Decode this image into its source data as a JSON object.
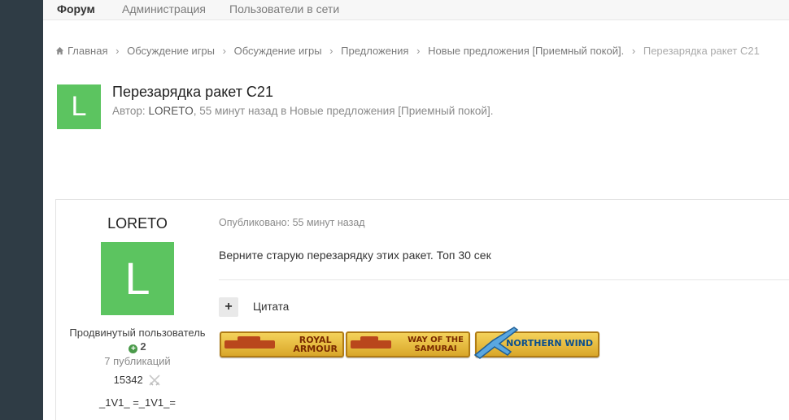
{
  "nav": {
    "items": [
      "Форум",
      "Администрация",
      "Пользователи в сети"
    ],
    "active_index": 0
  },
  "breadcrumb": {
    "items": [
      "Главная",
      "Обсуждение игры",
      "Обсуждение игры",
      "Предложения",
      "Новые предложения [Приемный покой]."
    ],
    "current": "Перезарядка ракет C21",
    "separator": "›"
  },
  "topic": {
    "avatar_letter": "L",
    "title": "Перезарядка ракет C21",
    "meta_prefix": "Автор:",
    "author": "LORETO",
    "meta_suffix": ", 55 минут назад в Новые предложения [Приемный покой]."
  },
  "post": {
    "author_name": "LORETO",
    "avatar_letter": "L",
    "rank": "Продвинутый пользователь",
    "reputation": "2",
    "publications": "7 публикаций",
    "stat_value": "15342",
    "signature": "_1V1_ =_1V1_=",
    "date": "Опубликовано: 55 минут назад",
    "text": "Верните старую перезарядку этих ракет. Топ 30 сек",
    "quote_button": "+",
    "quote_label": "Цитата",
    "badges": [
      {
        "line1": "ROYAL",
        "line2": "ARMOUR"
      },
      {
        "line1": "WAY OF THE",
        "line2": "SAMURAI"
      },
      {
        "line1": "NORTHERN WIND",
        "line2": ""
      }
    ]
  },
  "colors": {
    "avatar_green": "#5cc460",
    "left_rail": "#2f3c45",
    "badge_gold": "#e8bf42"
  }
}
